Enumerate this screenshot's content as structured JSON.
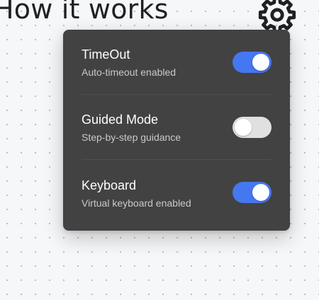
{
  "header": {
    "title": "How it works",
    "settings_icon": "gear-icon"
  },
  "settings_panel": {
    "items": [
      {
        "id": "timeout",
        "title": "TimeOut",
        "description": "Auto-timeout enabled",
        "enabled": true
      },
      {
        "id": "guided-mode",
        "title": "Guided Mode",
        "description": "Step-by-step guidance",
        "enabled": false
      },
      {
        "id": "keyboard",
        "title": "Keyboard",
        "description": "Virtual keyboard enabled",
        "enabled": true
      }
    ]
  },
  "colors": {
    "panel_background": "#424242",
    "toggle_on": "#4577f0",
    "toggle_off": "#e0e0e0",
    "page_background": "#f6f7f9"
  }
}
